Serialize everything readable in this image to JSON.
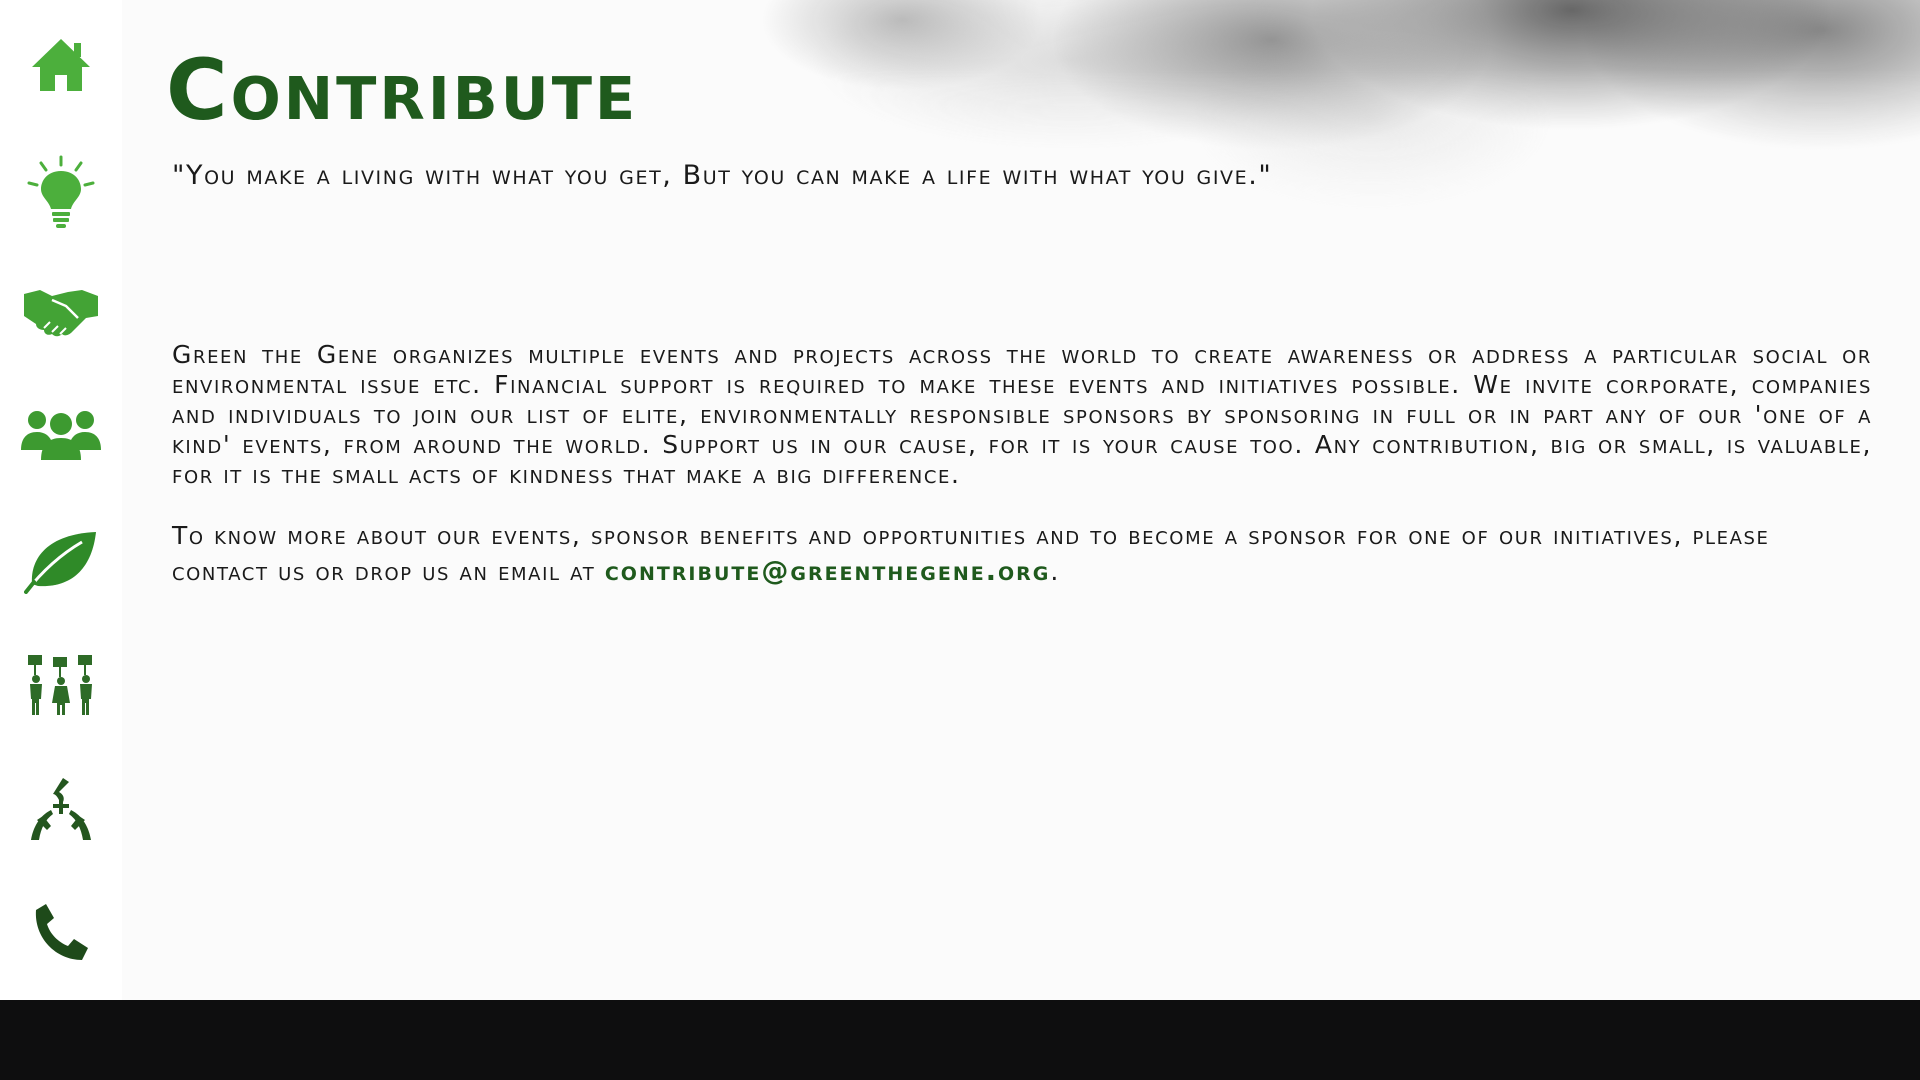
{
  "sidebar": {
    "items": [
      {
        "icon": "home-icon",
        "color": "#4caf3c"
      },
      {
        "icon": "lightbulb-icon",
        "color": "#4caf3c"
      },
      {
        "icon": "handshake-icon",
        "color": "#43a335"
      },
      {
        "icon": "people-group-icon",
        "color": "#3d9a30"
      },
      {
        "icon": "leaf-icon",
        "color": "#2f8a28"
      },
      {
        "icon": "protest-people-icon",
        "color": "#2e6b27"
      },
      {
        "icon": "caring-hands-icon",
        "color": "#24561f"
      },
      {
        "icon": "phone-icon",
        "color": "#1e4a1a"
      }
    ]
  },
  "main": {
    "title": "Contribute",
    "quote": "\"You make a living with what you get, But you can make a life with what you give.\"",
    "paragraph1": "Green the Gene organizes multiple events and projects across the world to create awareness or address a particular social or environmental issue etc. Financial support is required to make these events and initiatives possible. We invite corporate, companies and individuals to join our list of elite, environmentally responsible sponsors by sponsoring in full or in part any of our 'one of a kind' events, from around the world. Support us in our cause, for it is your cause too. Any contribution, big or small, is valuable, for it is the small acts of kindness that make a big difference.",
    "paragraph2_text": "To know more about our events, sponsor benefits and opportunities and to become a sponsor for one of our initiatives, please contact us or drop us an email at ",
    "email": "contribute@greenthegene.org",
    "paragraph2_end": "."
  },
  "colors": {
    "title": "#1f5a1d",
    "email": "#1f5a1d",
    "footer": "#0e0e0f"
  }
}
